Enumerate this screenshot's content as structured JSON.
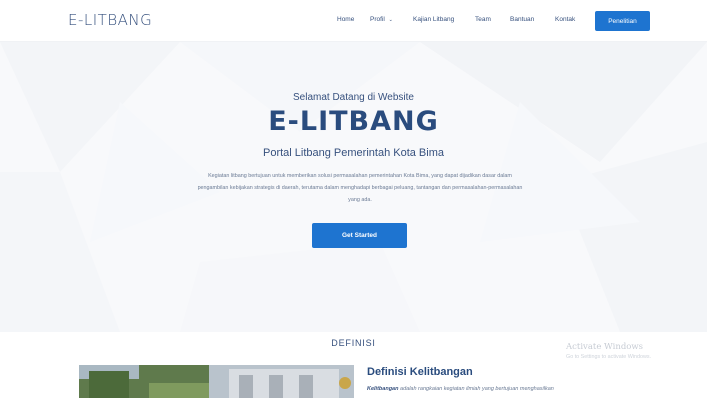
{
  "navbar": {
    "brand": "E-LITBANG",
    "links": [
      {
        "label": "Home"
      },
      {
        "label": "Profil",
        "dropdown": true
      },
      {
        "label": "Kajian Litbang"
      },
      {
        "label": "Team"
      },
      {
        "label": "Bantuan"
      },
      {
        "label": "Kontak"
      }
    ],
    "cta_label": "Penelitian"
  },
  "hero": {
    "greeting": "Selamat Datang di Website",
    "title": "E-LITBANG",
    "subtitle": "Portal Litbang Pemerintah Kota Bima",
    "description": "Kegiatan litbang bertujuan untuk memberikan solusi permasalahan pemerintahan Kota Bima, yang dapat dijadikan dasar dalam pengambilan kebijakan strategis di daerah, terutama dalam menghadapi berbagai peluang, tantangan dan permasalahan-permasalahan yang ada.",
    "cta_label": "Get Started"
  },
  "watermark": {
    "title": "Activate Windows",
    "subtitle": "Go to Settings to activate Windows."
  },
  "definisi": {
    "section_title": "DEFINISI",
    "heading": "Definisi Kelitbangan",
    "text_lead": "Kelitbangan",
    "text_rest": " adalah rangkaian kegiatan ilmiah yang bertujuan menghasilkan"
  },
  "colors": {
    "primary": "#1e74d0",
    "heading": "#37517e",
    "hero_bg": "#f8f9fb"
  }
}
